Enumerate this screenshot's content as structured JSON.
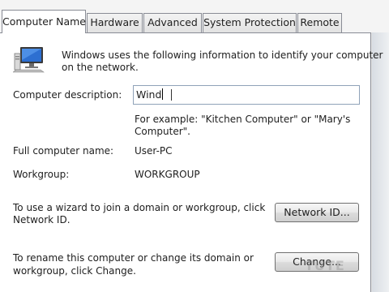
{
  "tabs": [
    {
      "label": "Computer Name",
      "active": true
    },
    {
      "label": "Hardware",
      "active": false
    },
    {
      "label": "Advanced",
      "active": false
    },
    {
      "label": "System Protection",
      "active": false
    },
    {
      "label": "Remote",
      "active": false
    }
  ],
  "intro": {
    "icon": "computer-monitor-icon",
    "line1": "Windows uses the following information to identify your computer",
    "line2": "on the network."
  },
  "description": {
    "label": "Computer description:",
    "value": "Wind",
    "example_line1": "For example: \"Kitchen Computer\" or \"Mary's",
    "example_line2": "Computer\"."
  },
  "full_name": {
    "label": "Full computer name:",
    "value": "User-PC"
  },
  "workgroup": {
    "label": "Workgroup:",
    "value": "WORKGROUP"
  },
  "network_id": {
    "text_line1": "To use a wizard to join a domain or workgroup, click",
    "text_line2": "Network ID.",
    "button_label": "Network ID..."
  },
  "change": {
    "text_line1": "To rename this computer or change its domain or",
    "text_line2": "workgroup, click Change.",
    "button_label": "Change..."
  },
  "colors": {
    "accent_border": "#898c95",
    "field_border": "#8fa2b8"
  }
}
